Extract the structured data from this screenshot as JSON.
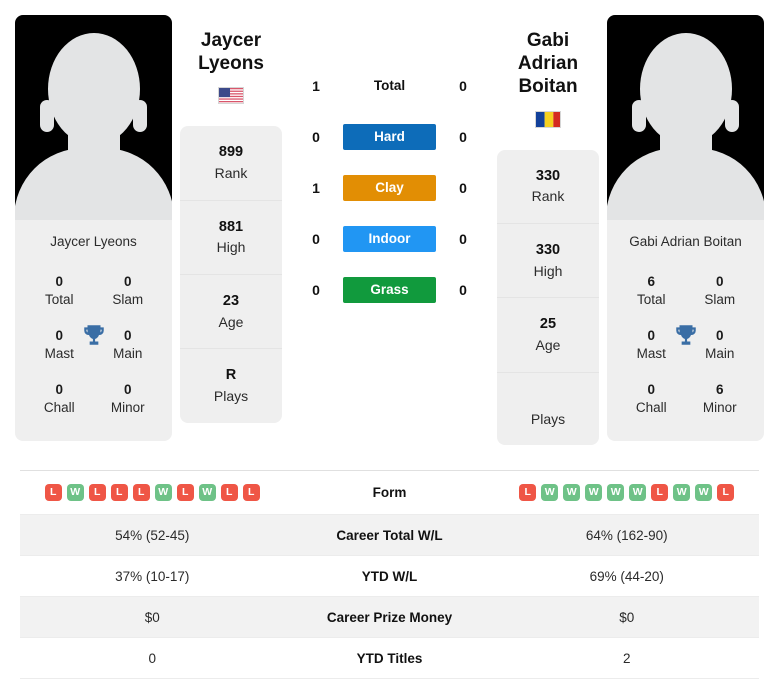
{
  "players": {
    "left": {
      "name_line1": "Jaycer",
      "name_line2": "Lyeons",
      "full_name": "Jaycer Lyeons",
      "country": "United States",
      "flag": "us-flag-icon",
      "rank": "899",
      "rank_label": "Rank",
      "high": "881",
      "high_label": "High",
      "age": "23",
      "age_label": "Age",
      "plays": "R",
      "plays_label": "Plays",
      "titles": {
        "total": "0",
        "total_label": "Total",
        "slam": "0",
        "slam_label": "Slam",
        "mast": "0",
        "mast_label": "Mast",
        "main": "0",
        "main_label": "Main",
        "chall": "0",
        "chall_label": "Chall",
        "minor": "0",
        "minor_label": "Minor"
      }
    },
    "right": {
      "name_line1": "Gabi Adrian",
      "name_line2": "Boitan",
      "full_name": "Gabi Adrian Boitan",
      "country": "Romania",
      "flag": "ro-flag-icon",
      "rank": "330",
      "rank_label": "Rank",
      "high": "330",
      "high_label": "High",
      "age": "25",
      "age_label": "Age",
      "plays": "",
      "plays_label": "Plays",
      "titles": {
        "total": "6",
        "total_label": "Total",
        "slam": "0",
        "slam_label": "Slam",
        "mast": "0",
        "mast_label": "Mast",
        "main": "0",
        "main_label": "Main",
        "chall": "0",
        "chall_label": "Chall",
        "minor": "6",
        "minor_label": "Minor"
      }
    }
  },
  "surfaces": [
    {
      "label": "Total",
      "left": "1",
      "right": "0",
      "color": "",
      "style": "plain"
    },
    {
      "label": "Hard",
      "left": "0",
      "right": "0",
      "color": "#0d6cb9",
      "style": "pill"
    },
    {
      "label": "Clay",
      "left": "1",
      "right": "0",
      "color": "#e28e04",
      "style": "pill"
    },
    {
      "label": "Indoor",
      "left": "0",
      "right": "0",
      "color": "#2196f3",
      "style": "pill"
    },
    {
      "label": "Grass",
      "left": "0",
      "right": "0",
      "color": "#119a3d",
      "style": "pill"
    }
  ],
  "table": {
    "form": {
      "label": "Form",
      "left": [
        "L",
        "W",
        "L",
        "L",
        "L",
        "W",
        "L",
        "W",
        "L",
        "L"
      ],
      "right": [
        "L",
        "W",
        "W",
        "W",
        "W",
        "W",
        "L",
        "W",
        "W",
        "L"
      ]
    },
    "rows": [
      {
        "label": "Career Total W/L",
        "left": "54% (52-45)",
        "right": "64% (162-90)"
      },
      {
        "label": "YTD W/L",
        "left": "37% (10-17)",
        "right": "69% (44-20)"
      },
      {
        "label": "Career Prize Money",
        "left": "$0",
        "right": "$0"
      },
      {
        "label": "YTD Titles",
        "left": "0",
        "right": "2"
      }
    ]
  },
  "colors": {
    "win": "#6ec287",
    "loss": "#ef5646",
    "trophy": "#3a6ea5",
    "panel": "#efefef",
    "stripe": "#f2f2f2"
  }
}
